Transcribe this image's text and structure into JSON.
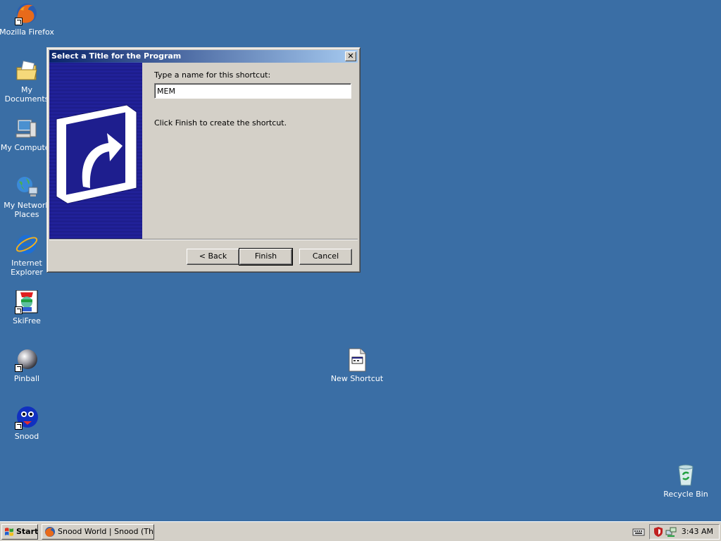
{
  "desktop": {
    "icons": [
      {
        "label": "Mozilla Firefox"
      },
      {
        "label": "My Documents"
      },
      {
        "label": "My Computer"
      },
      {
        "label": "My Network\nPlaces"
      },
      {
        "label": "Internet\nExplorer"
      },
      {
        "label": "SkiFree"
      },
      {
        "label": "Pinball"
      },
      {
        "label": "Snood"
      },
      {
        "label": "New Shortcut"
      },
      {
        "label": "Recycle Bin"
      }
    ]
  },
  "dialog": {
    "title": "Select a Title for the Program",
    "close_glyph": "✕",
    "prompt": "Type a name for this shortcut:",
    "name_value": "MEM",
    "instructions": "Click Finish to create the shortcut.",
    "buttons": {
      "back": "< Back",
      "finish": "Finish",
      "cancel": "Cancel"
    }
  },
  "taskbar": {
    "start_label": "Start",
    "task_label": "Snood World | Snood (Th...",
    "clock": "3:43 AM"
  },
  "colors": {
    "desktop": "#3A6EA5",
    "title_active": "#0A246A",
    "face": "#D4D0C8"
  }
}
